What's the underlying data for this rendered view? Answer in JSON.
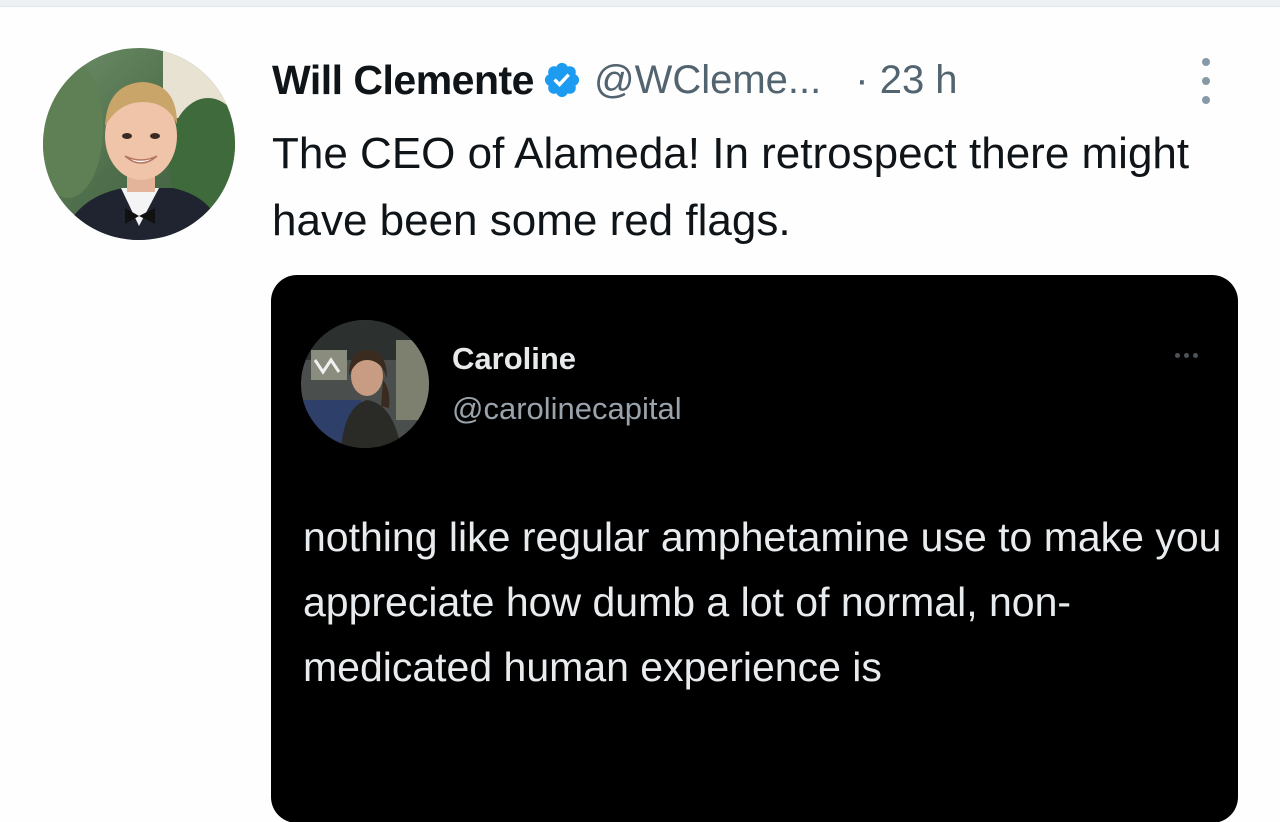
{
  "tweet": {
    "author": {
      "display_name": "Will Clemente",
      "handle": "@WCleme...",
      "verified_icon": "verified-badge-icon"
    },
    "timestamp": "· 23 h",
    "more_icon": "more-vertical-icon",
    "text": "The CEO of Alameda! In retrospect there might have been some red flags."
  },
  "quoted_tweet": {
    "author": {
      "display_name": "Caroline",
      "handle": "@carolinecapital"
    },
    "more_icon": "more-horizontal-icon",
    "text": "nothing like regular amphetamine use to make you appreciate how dumb a lot of normal, non-medicated human experience is"
  },
  "colors": {
    "verified_blue": "#1d9bf0",
    "primary_text": "#0f1419",
    "secondary_text": "#536471",
    "quote_background": "#000000",
    "quote_text": "#e9ecee"
  }
}
